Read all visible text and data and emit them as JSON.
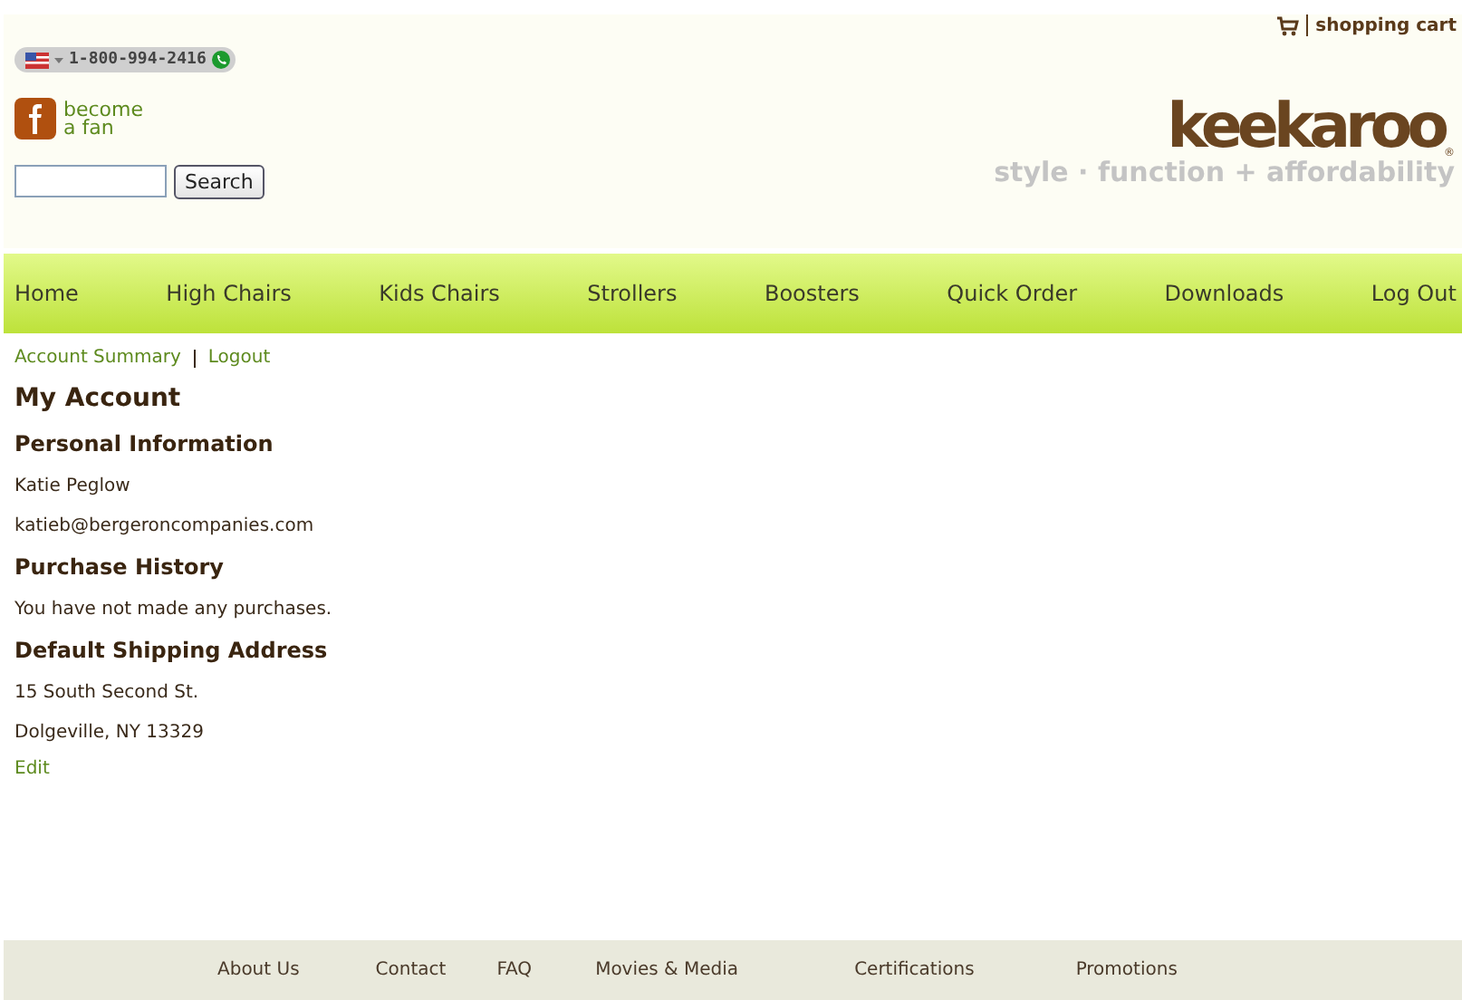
{
  "header": {
    "phone": "1-800-994-2416",
    "facebook": "become\na fan",
    "search_button": "Search",
    "cart": "shopping cart",
    "logo": "keekaroo",
    "logo_mark": "®",
    "tagline": "style · function + affordability"
  },
  "nav": [
    {
      "label": "Home"
    },
    {
      "label": "High Chairs"
    },
    {
      "label": "Kids Chairs"
    },
    {
      "label": "Strollers"
    },
    {
      "label": "Boosters"
    },
    {
      "label": "Quick Order"
    },
    {
      "label": "Downloads"
    },
    {
      "label": "Log Out"
    }
  ],
  "account_links": [
    "Account Summary",
    "Logout"
  ],
  "title": "My Account",
  "sections": [
    {
      "heading": "Personal Information",
      "lines": [
        "Katie Peglow",
        "katieb@bergeroncompanies.com"
      ]
    },
    {
      "heading": "Purchase History",
      "lines": [
        "You have not made any purchases."
      ]
    },
    {
      "heading": "Default Shipping Address",
      "lines": [
        "15 South Second St.",
        "Dolgeville, NY 13329"
      ]
    }
  ],
  "edit_link": "Edit",
  "footer": [
    "About Us",
    "Contact",
    "FAQ",
    "Movies & Media",
    "Certifications",
    "Promotions"
  ]
}
